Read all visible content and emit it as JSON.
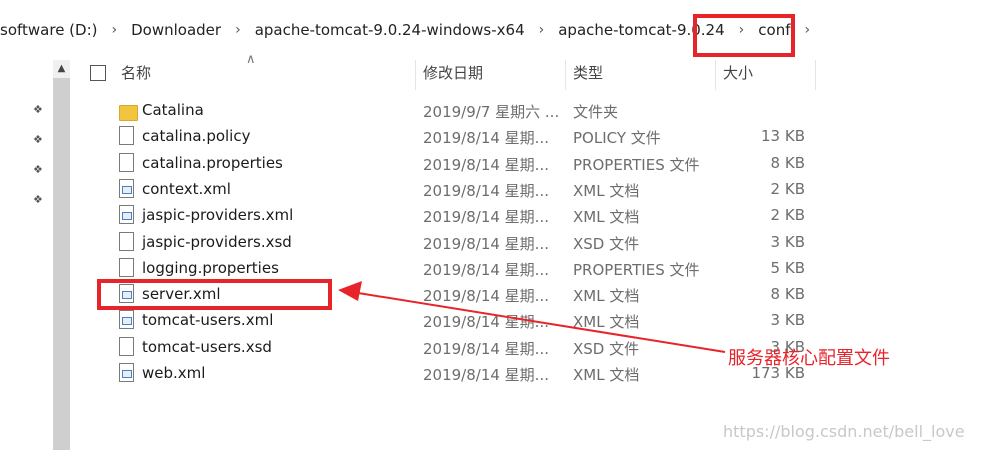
{
  "breadcrumb": [
    {
      "label": "software (D:)"
    },
    {
      "label": "Downloader"
    },
    {
      "label": "apache-tomcat-9.0.24-windows-x64"
    },
    {
      "label": "apache-tomcat-9.0.24"
    },
    {
      "label": "conf"
    }
  ],
  "columns": {
    "name": "名称",
    "date": "修改日期",
    "type": "类型",
    "size": "大小"
  },
  "files": [
    {
      "icon": "folder-icon",
      "name": "Catalina",
      "date": "2019/9/7 星期六 ...",
      "type": "文件夹",
      "size": ""
    },
    {
      "icon": "file-icon",
      "name": "catalina.policy",
      "date": "2019/8/14 星期...",
      "type": "POLICY 文件",
      "size": "13 KB"
    },
    {
      "icon": "file-icon",
      "name": "catalina.properties",
      "date": "2019/8/14 星期...",
      "type": "PROPERTIES 文件",
      "size": "8 KB"
    },
    {
      "icon": "xml-file-icon",
      "name": "context.xml",
      "date": "2019/8/14 星期...",
      "type": "XML 文档",
      "size": "2 KB"
    },
    {
      "icon": "xml-file-icon",
      "name": "jaspic-providers.xml",
      "date": "2019/8/14 星期...",
      "type": "XML 文档",
      "size": "2 KB"
    },
    {
      "icon": "file-icon",
      "name": "jaspic-providers.xsd",
      "date": "2019/8/14 星期...",
      "type": "XSD 文件",
      "size": "3 KB"
    },
    {
      "icon": "file-icon",
      "name": "logging.properties",
      "date": "2019/8/14 星期...",
      "type": "PROPERTIES 文件",
      "size": "5 KB"
    },
    {
      "icon": "xml-file-icon",
      "name": "server.xml",
      "date": "2019/8/14 星期...",
      "type": "XML 文档",
      "size": "8 KB"
    },
    {
      "icon": "xml-file-icon",
      "name": "tomcat-users.xml",
      "date": "2019/8/14 星期...",
      "type": "XML 文档",
      "size": "3 KB"
    },
    {
      "icon": "file-icon",
      "name": "tomcat-users.xsd",
      "date": "2019/8/14 星期...",
      "type": "XSD 文件",
      "size": "3 KB"
    },
    {
      "icon": "xml-file-icon",
      "name": "web.xml",
      "date": "2019/8/14 星期...",
      "type": "XML 文档",
      "size": "173 KB"
    }
  ],
  "annotation": "服务器核心配置文件",
  "watermark": "https://blog.csdn.net/bell_love",
  "colors": {
    "highlight": "#e8242b",
    "folder": "#f3c53f"
  }
}
